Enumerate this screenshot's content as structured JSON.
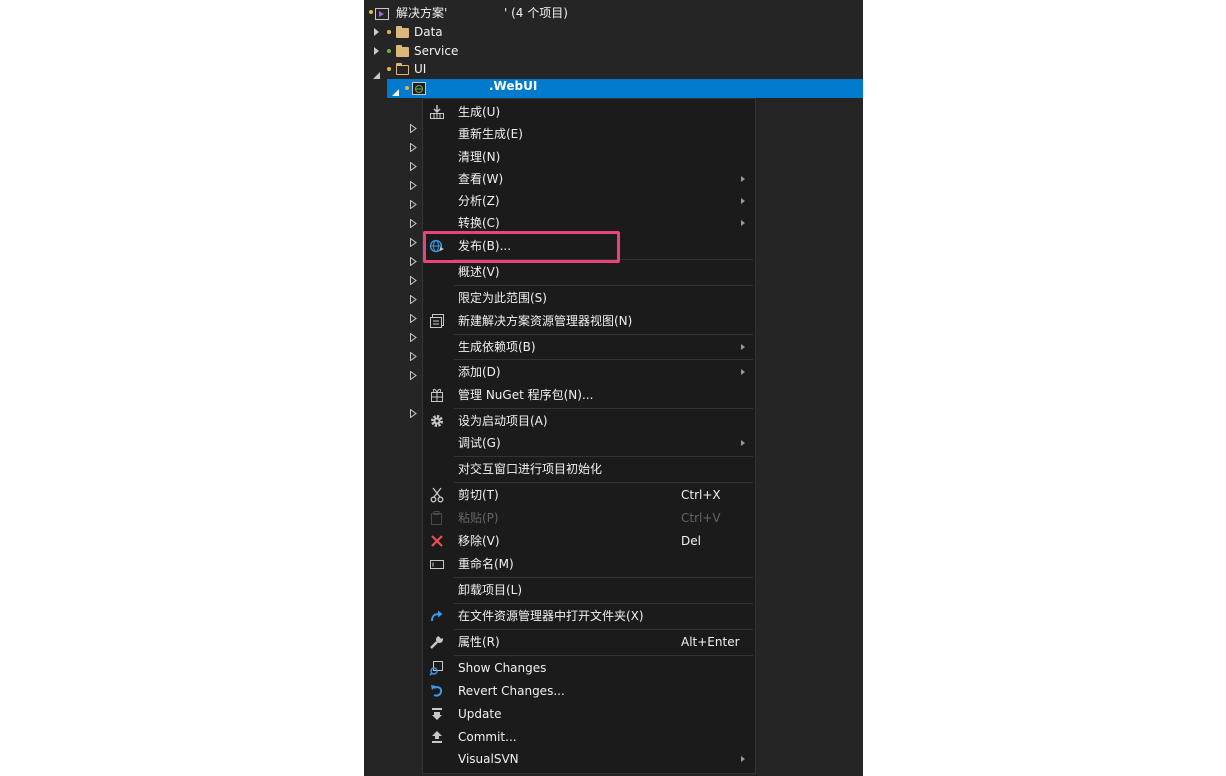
{
  "solution": {
    "title": "解决方案'",
    "suffix": "' (4 个项目)"
  },
  "tree": {
    "data_folder": "Data",
    "service_folder": "Service",
    "ui_folder": "UI",
    "webui_project": ".WebUI"
  },
  "menu": {
    "build": "生成(U)",
    "rebuild": "重新生成(E)",
    "clean": "清理(N)",
    "view": "查看(W)",
    "analyze": "分析(Z)",
    "convert": "转换(C)",
    "publish": "发布(B)...",
    "overview": "概述(V)",
    "scope": "限定为此范围(S)",
    "new_view": "新建解决方案资源管理器视图(N)",
    "build_deps": "生成依赖项(B)",
    "add": "添加(D)",
    "nuget": "管理 NuGet 程序包(N)...",
    "startup": "设为启动项目(A)",
    "debug": "调试(G)",
    "interactive": "对交互窗口进行项目初始化",
    "cut": "剪切(T)",
    "cut_shortcut": "Ctrl+X",
    "paste": "粘贴(P)",
    "paste_shortcut": "Ctrl+V",
    "remove": "移除(V)",
    "remove_shortcut": "Del",
    "rename": "重命名(M)",
    "unload": "卸载项目(L)",
    "open_folder": "在文件资源管理器中打开文件夹(X)",
    "properties": "属性(R)",
    "properties_shortcut": "Alt+Enter",
    "show_changes": "Show Changes",
    "revert_changes": "Revert Changes...",
    "update": "Update",
    "commit": "Commit...",
    "visualsvn": "VisualSVN"
  },
  "colors": {
    "panel_bg": "#252526",
    "menu_bg": "#1b1b1c",
    "selection": "#007acc",
    "highlight_border": "#e8437a"
  }
}
